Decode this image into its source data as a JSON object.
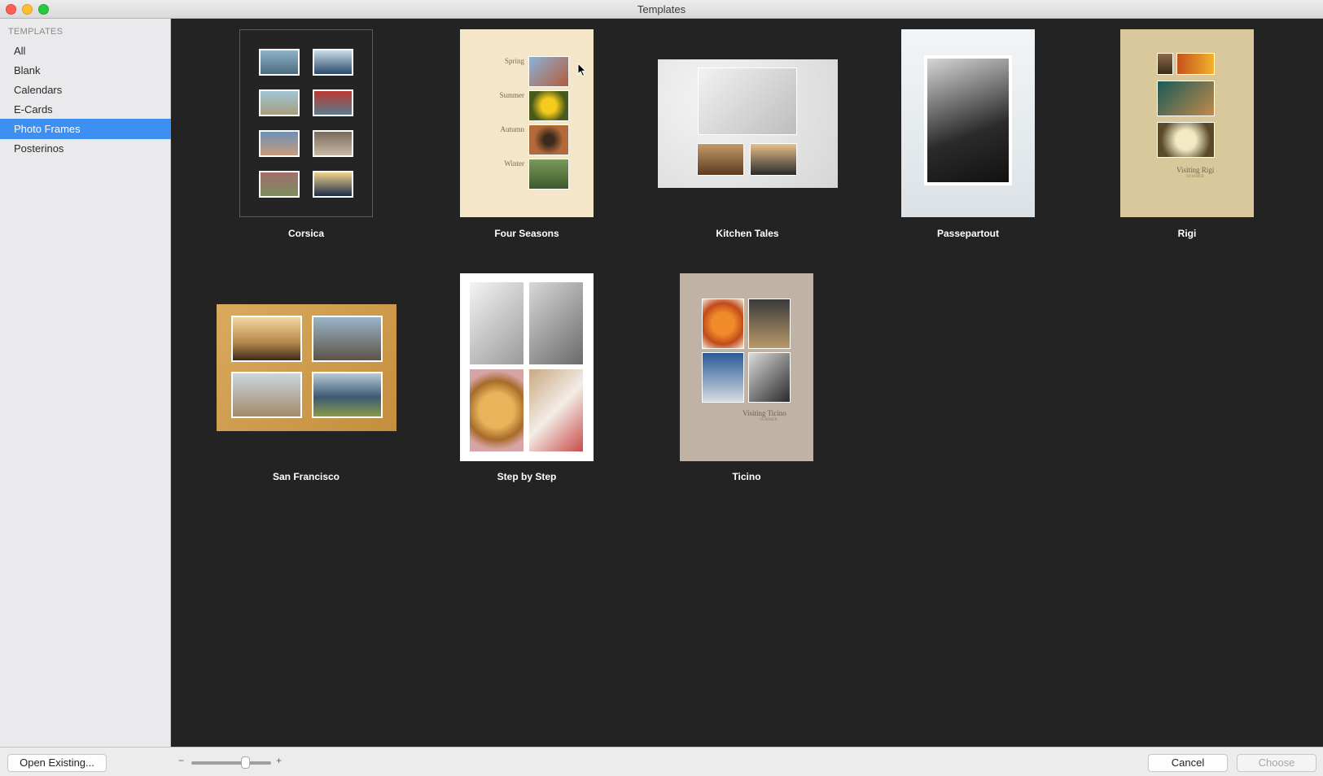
{
  "window": {
    "title": "Templates"
  },
  "sidebar": {
    "heading": "TEMPLATES",
    "items": [
      {
        "label": "All"
      },
      {
        "label": "Blank"
      },
      {
        "label": "Calendars"
      },
      {
        "label": "E-Cards"
      },
      {
        "label": "Photo Frames",
        "selected": true
      },
      {
        "label": "Posterinos"
      }
    ]
  },
  "templates": [
    {
      "name": "Corsica"
    },
    {
      "name": "Four Seasons",
      "labels": [
        "Spring",
        "Summer",
        "Autumn",
        "Winter"
      ]
    },
    {
      "name": "Kitchen Tales"
    },
    {
      "name": "Passepartout"
    },
    {
      "name": "Rigi",
      "caption": "Visiting Rigi",
      "subcaption": "SUMMER"
    },
    {
      "name": "San Francisco"
    },
    {
      "name": "Step by Step"
    },
    {
      "name": "Ticino",
      "caption": "Visiting Ticino",
      "subcaption": "SUMMER"
    }
  ],
  "footer": {
    "open_existing": "Open Existing...",
    "cancel": "Cancel",
    "choose": "Choose",
    "zoom_minus": "−",
    "zoom_plus": "+"
  },
  "colors": {
    "accent": "#3d8ff1",
    "main_bg": "#232323",
    "sidebar_bg": "#eaeaed"
  }
}
